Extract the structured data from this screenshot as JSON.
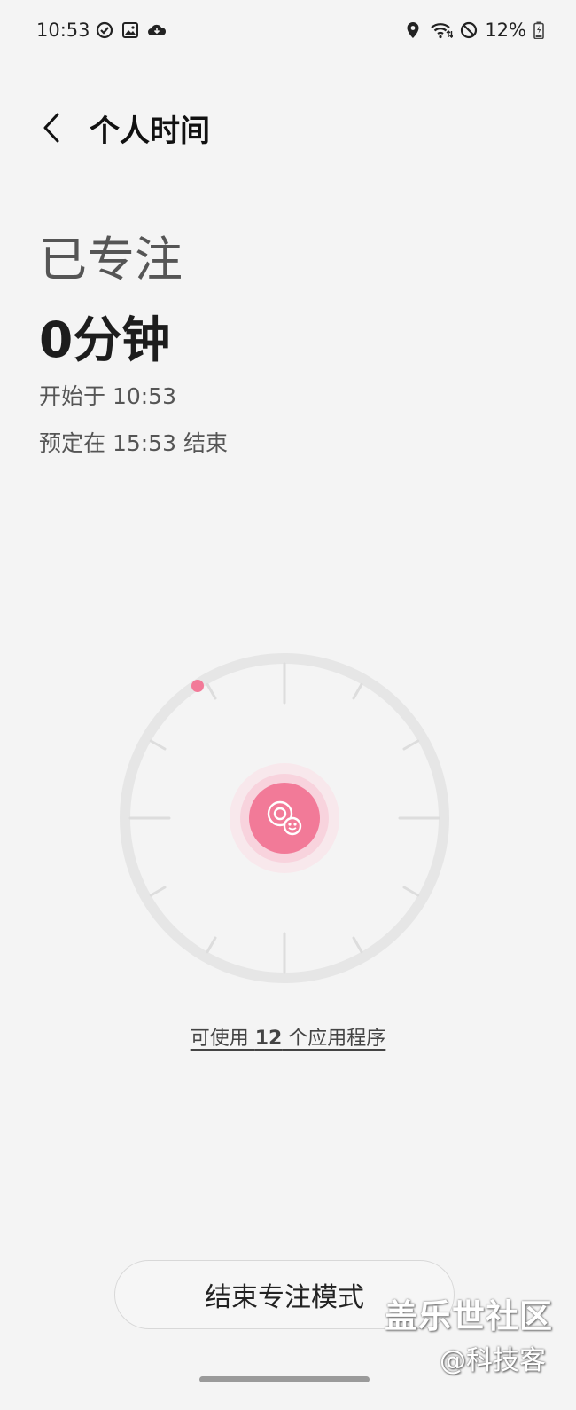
{
  "status_bar": {
    "time": "10:53",
    "battery": "12%",
    "left_icons": [
      "sync-icon",
      "image-icon",
      "cloud-icon"
    ],
    "right_icons": [
      "location-icon",
      "wifi-icon",
      "do-not-disturb-icon",
      "battery-icon"
    ]
  },
  "header": {
    "back_icon": "chevron-left-icon",
    "title": "个人时间"
  },
  "focus": {
    "label": "已专注",
    "duration": "0分钟",
    "start": "开始于 10:53",
    "end": "预定在 15:53 结束"
  },
  "dial": {
    "center_icon": "focus-mode-icon",
    "progress": 0,
    "accent": "#f27a98"
  },
  "apps_link": {
    "prefix": "可使用 ",
    "count": "12",
    "suffix": " 个应用程序"
  },
  "end_button": {
    "label": "结束专注模式"
  },
  "watermark": {
    "line1": "盖乐世社区",
    "line2": "@科技客"
  }
}
